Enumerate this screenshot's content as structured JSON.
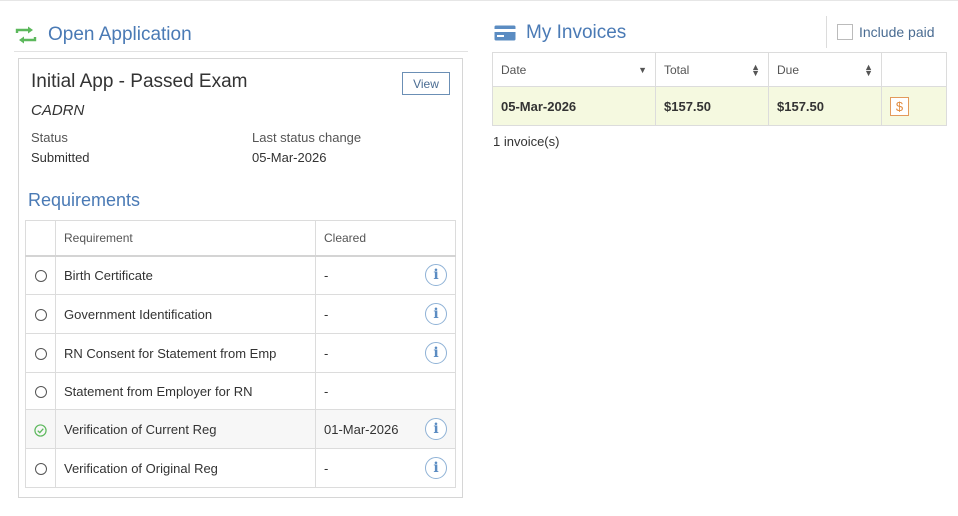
{
  "left": {
    "header_title": "Open Application",
    "app_name": "Initial App - Passed Exam",
    "view_label": "View",
    "app_code": "CADRN",
    "status_label": "Status",
    "status_value": "Submitted",
    "change_label": "Last status change",
    "change_value": "05-Mar-2026",
    "requirements_title": "Requirements",
    "columns": [
      "Requirement",
      "Cleared"
    ],
    "rows": [
      {
        "requirement": "Birth Certificate",
        "cleared": "-",
        "done": false,
        "info": true
      },
      {
        "requirement": "Government Identification",
        "cleared": "-",
        "done": false,
        "info": true
      },
      {
        "requirement": "RN Consent for Statement from Emp",
        "cleared": "-",
        "done": false,
        "info": true
      },
      {
        "requirement": "Statement from Employer for RN",
        "cleared": "-",
        "done": false,
        "info": false
      },
      {
        "requirement": "Verification of Current Reg",
        "cleared": "01-Mar-2026",
        "done": true,
        "info": true
      },
      {
        "requirement": "Verification of Original Reg",
        "cleared": "-",
        "done": false,
        "info": true
      }
    ]
  },
  "right": {
    "header_title": "My Invoices",
    "include_paid_label": "Include paid",
    "columns": [
      "Date",
      "Total",
      "Due"
    ],
    "invoices": [
      {
        "date": "05-Mar-2026",
        "total": "$157.50",
        "due": "$157.50",
        "pay_label": "$"
      }
    ],
    "count_text": "1 invoice(s)"
  },
  "icons": {
    "open_application": "refresh-arrows-icon",
    "invoices": "credit-card-icon",
    "info": "info-icon",
    "pending": "radio-empty-icon",
    "done": "check-circle-icon",
    "pay": "dollar-icon"
  },
  "colors": {
    "accent": "#4a7ab5",
    "success": "#5cb85c",
    "invoice_row": "#f5f9e0",
    "pay": "#e08a3c"
  }
}
